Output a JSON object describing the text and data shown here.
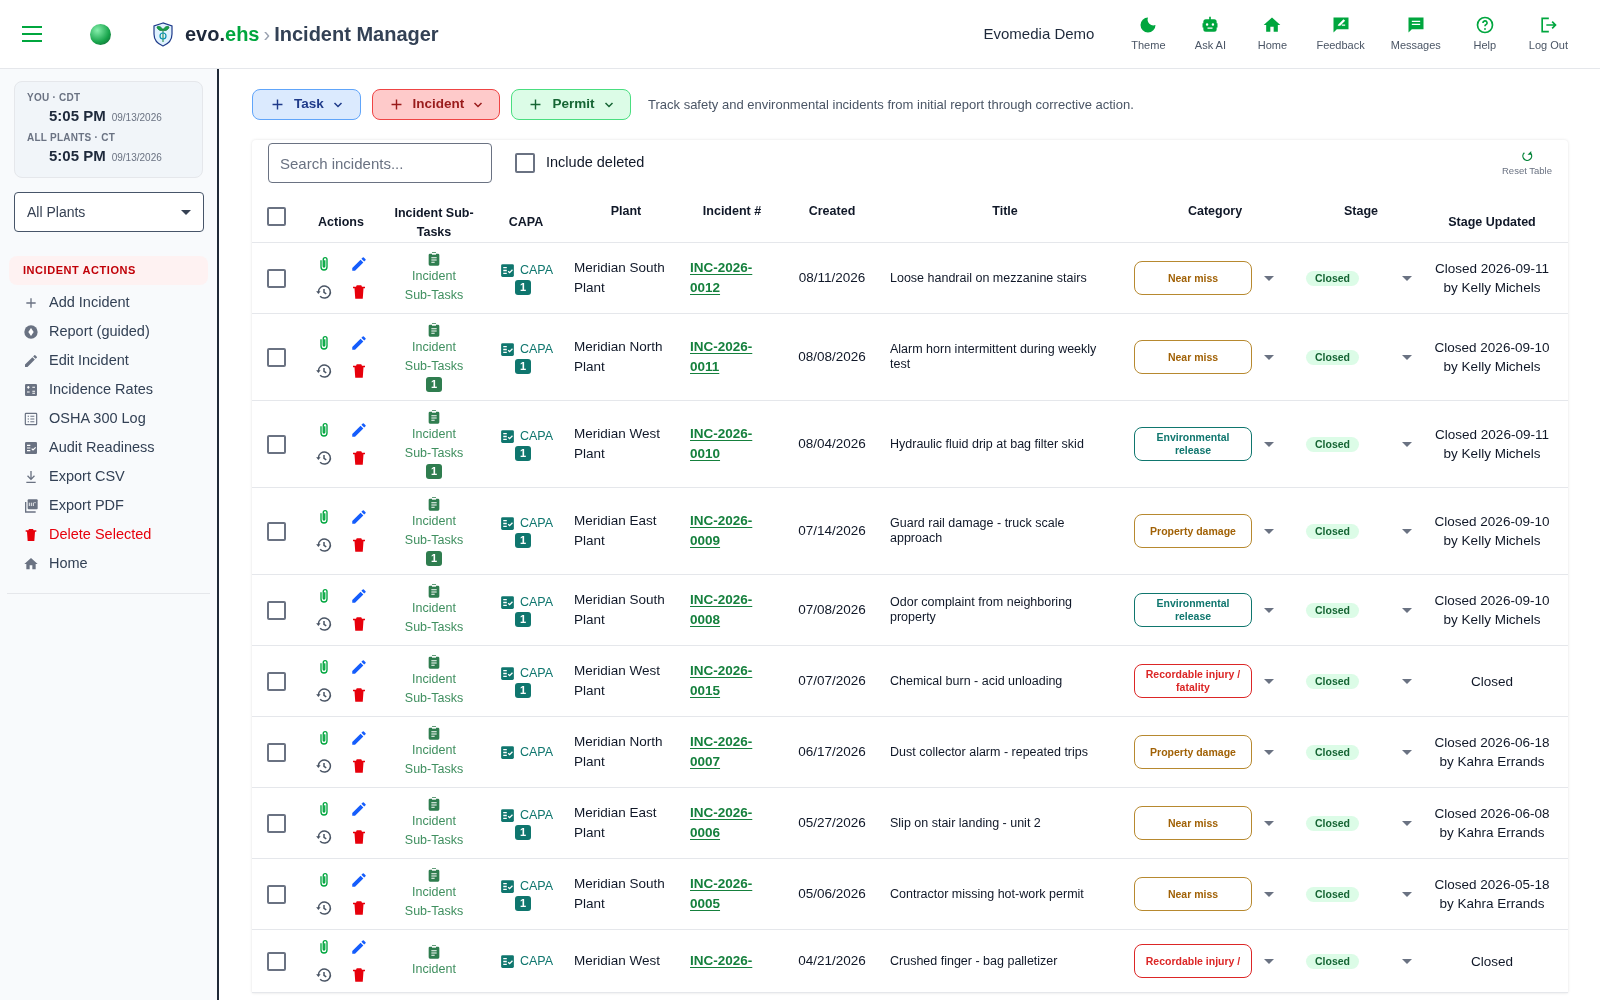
{
  "header": {
    "brand_main": "evo.",
    "brand_accent": "ehs",
    "separator": "›",
    "page_title": "Incident Manager",
    "account": "Evomedia Demo",
    "nav": [
      {
        "label": "Theme"
      },
      {
        "label": "Ask AI"
      },
      {
        "label": "Home"
      },
      {
        "label": "Feedback"
      },
      {
        "label": "Messages"
      },
      {
        "label": "Help"
      },
      {
        "label": "Log Out"
      }
    ]
  },
  "sidebar": {
    "clocks": [
      {
        "label": "YOU · CDT",
        "time": "5:05 PM",
        "date": "09/13/2026"
      },
      {
        "label": "ALL PLANTS · CT",
        "time": "5:05 PM",
        "date": "09/13/2026"
      }
    ],
    "plant_select": "All Plants",
    "section_title": "INCIDENT ACTIONS",
    "items": [
      {
        "label": "Add Incident",
        "kind": "normal"
      },
      {
        "label": "Report (guided)",
        "kind": "normal"
      },
      {
        "label": "Edit Incident",
        "kind": "normal"
      },
      {
        "label": "Incidence Rates",
        "kind": "normal"
      },
      {
        "label": "OSHA 300 Log",
        "kind": "normal"
      },
      {
        "label": "Audit Readiness",
        "kind": "normal"
      },
      {
        "label": "Export CSV",
        "kind": "normal"
      },
      {
        "label": "Export PDF",
        "kind": "normal"
      },
      {
        "label": "Delete Selected",
        "kind": "danger"
      },
      {
        "label": "Home",
        "kind": "normal"
      }
    ]
  },
  "toolbar": {
    "buttons": [
      {
        "label": "Task",
        "kind": "blue"
      },
      {
        "label": "Incident",
        "kind": "red"
      },
      {
        "label": "Permit",
        "kind": "green"
      }
    ],
    "description": "Track safety and environmental incidents from initial report through corrective action."
  },
  "search": {
    "placeholder": "Search incidents..."
  },
  "include_deleted": {
    "label": "Include deleted",
    "checked": false
  },
  "reset_table": "Reset Table",
  "table": {
    "select_all_checked": false,
    "columns": [
      "Actions",
      "Incident Sub-Tasks",
      "CAPA",
      "Plant",
      "Incident #",
      "Created",
      "Title",
      "Category",
      "Stage",
      "Stage Updated"
    ],
    "rows": [
      {
        "checked": false,
        "subtasks": "Incident Sub-Tasks",
        "capa": "CAPA",
        "capa_count": "1",
        "plant": "Meridian South Plant",
        "incident": "INC-2026-0012",
        "created": "08/11/2026",
        "title": "Loose handrail on mezzanine stairs",
        "category": {
          "label": "Near miss",
          "kind": "near_miss"
        },
        "stage": "Closed",
        "stage_updated": "Closed 2026-09-11 by Kelly Michels"
      },
      {
        "checked": false,
        "subtasks": "Incident Sub-Tasks",
        "subtask_count": "1",
        "capa": "CAPA",
        "capa_count": "1",
        "plant": "Meridian North Plant",
        "incident": "INC-2026-0011",
        "created": "08/08/2026",
        "title": "Alarm horn intermittent during weekly test",
        "category": {
          "label": "Near miss",
          "kind": "near_miss"
        },
        "stage": "Closed",
        "stage_updated": "Closed 2026-09-10 by Kelly Michels"
      },
      {
        "checked": false,
        "subtasks": "Incident Sub-Tasks",
        "subtask_count": "1",
        "capa": "CAPA",
        "capa_count": "1",
        "plant": "Meridian West Plant",
        "incident": "INC-2026-0010",
        "created": "08/04/2026",
        "title": "Hydraulic fluid drip at bag filter skid",
        "category": {
          "label": "Environmental release",
          "kind": "environmental"
        },
        "stage": "Closed",
        "stage_updated": "Closed 2026-09-11 by Kelly Michels"
      },
      {
        "checked": false,
        "subtasks": "Incident Sub-Tasks",
        "subtask_count": "1",
        "capa": "CAPA",
        "capa_count": "1",
        "plant": "Meridian East Plant",
        "incident": "INC-2026-0009",
        "created": "07/14/2026",
        "title": "Guard rail damage - truck scale approach",
        "category": {
          "label": "Property damage",
          "kind": "property"
        },
        "stage": "Closed",
        "stage_updated": "Closed 2026-09-10 by Kelly Michels"
      },
      {
        "checked": false,
        "subtasks": "Incident Sub-Tasks",
        "capa": "CAPA",
        "capa_count": "1",
        "plant": "Meridian South Plant",
        "incident": "INC-2026-0008",
        "created": "07/08/2026",
        "title": "Odor complaint from neighboring property",
        "category": {
          "label": "Environmental release",
          "kind": "environmental"
        },
        "stage": "Closed",
        "stage_updated": "Closed 2026-09-10 by Kelly Michels"
      },
      {
        "checked": false,
        "subtasks": "Incident Sub-Tasks",
        "capa": "CAPA",
        "capa_count": "1",
        "plant": "Meridian West Plant",
        "incident": "INC-2026-0015",
        "created": "07/07/2026",
        "title": "Chemical burn - acid unloading",
        "category": {
          "label": "Recordable injury / fatality",
          "kind": "recordable"
        },
        "stage": "Closed",
        "stage_updated": "Closed"
      },
      {
        "checked": false,
        "subtasks": "Incident Sub-Tasks",
        "capa": "CAPA",
        "plant": "Meridian North Plant",
        "incident": "INC-2026-0007",
        "created": "06/17/2026",
        "title": "Dust collector alarm - repeated trips",
        "category": {
          "label": "Property damage",
          "kind": "property"
        },
        "stage": "Closed",
        "stage_updated": "Closed 2026-06-18 by Kahra Errands"
      },
      {
        "checked": false,
        "subtasks": "Incident Sub-Tasks",
        "capa": "CAPA",
        "capa_count": "1",
        "plant": "Meridian East Plant",
        "incident": "INC-2026-0006",
        "created": "05/27/2026",
        "title": "Slip on stair landing - unit 2",
        "category": {
          "label": "Near miss",
          "kind": "near_miss"
        },
        "stage": "Closed",
        "stage_updated": "Closed 2026-06-08 by Kahra Errands"
      },
      {
        "checked": false,
        "subtasks": "Incident Sub-Tasks",
        "capa": "CAPA",
        "capa_count": "1",
        "plant": "Meridian South Plant",
        "incident": "INC-2026-0005",
        "created": "05/06/2026",
        "title": "Contractor missing hot-work permit",
        "category": {
          "label": "Near miss",
          "kind": "near_miss"
        },
        "stage": "Closed",
        "stage_updated": "Closed 2026-05-18 by Kahra Errands"
      },
      {
        "checked": false,
        "subtasks": "Incident",
        "capa": "CAPA",
        "plant": "Meridian West",
        "incident": "INC-2026-",
        "created": "04/21/2026",
        "title": "Crushed finger - bag palletizer",
        "category": {
          "label": "Recordable injury /",
          "kind": "recordable"
        },
        "stage": "Closed",
        "stage_updated": "Closed"
      }
    ]
  }
}
